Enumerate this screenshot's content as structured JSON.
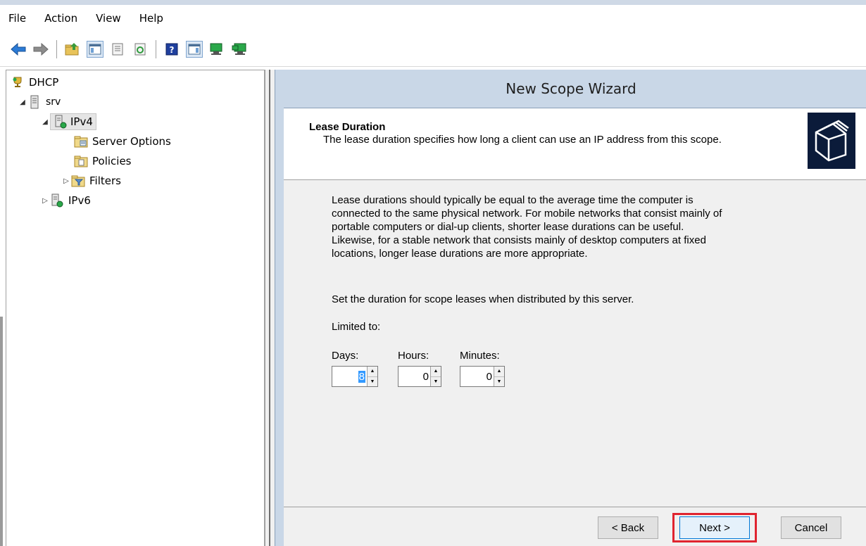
{
  "menu": [
    "File",
    "Action",
    "View",
    "Help"
  ],
  "toolbar_icons": [
    "back-arrow-icon",
    "forward-arrow-icon",
    "up-folder-icon",
    "show-hide-console-tree-icon",
    "properties-icon",
    "refresh-icon",
    "help-icon",
    "show-action-pane-icon",
    "display-statistics-icon",
    "authorize-server-icon"
  ],
  "tree": {
    "root": "DHCP",
    "server": "srv",
    "ipv4": "IPv4",
    "server_options": "Server Options",
    "policies": "Policies",
    "filters": "Filters",
    "ipv6": "IPv6"
  },
  "wizard": {
    "title": "New Scope Wizard",
    "section_title": "Lease Duration",
    "section_desc": "The lease duration specifies how long a client can use an IP address from this scope.",
    "body_lines": [
      "Lease durations should typically be equal to the average time the computer is",
      "connected to the same physical network. For mobile networks that consist mainly of",
      "portable computers or dial-up clients, shorter lease durations can be useful.",
      "Likewise, for a stable network that consists mainly of desktop computers at fixed",
      "locations, longer lease durations are more appropriate."
    ],
    "set_duration": "Set the duration for scope leases when distributed by this server.",
    "limited_to": "Limited to:",
    "days_label": "Days:",
    "hours_label": "Hours:",
    "minutes_label": "Minutes:",
    "days_value": "8",
    "hours_value": "0",
    "minutes_value": "0",
    "back_button": "< Back",
    "next_button": "Next >",
    "cancel_button": "Cancel"
  },
  "colors": {
    "wizard_bg": "#c9d7e7",
    "highlight_border": "#e0242f",
    "selection": "#3399ff"
  }
}
